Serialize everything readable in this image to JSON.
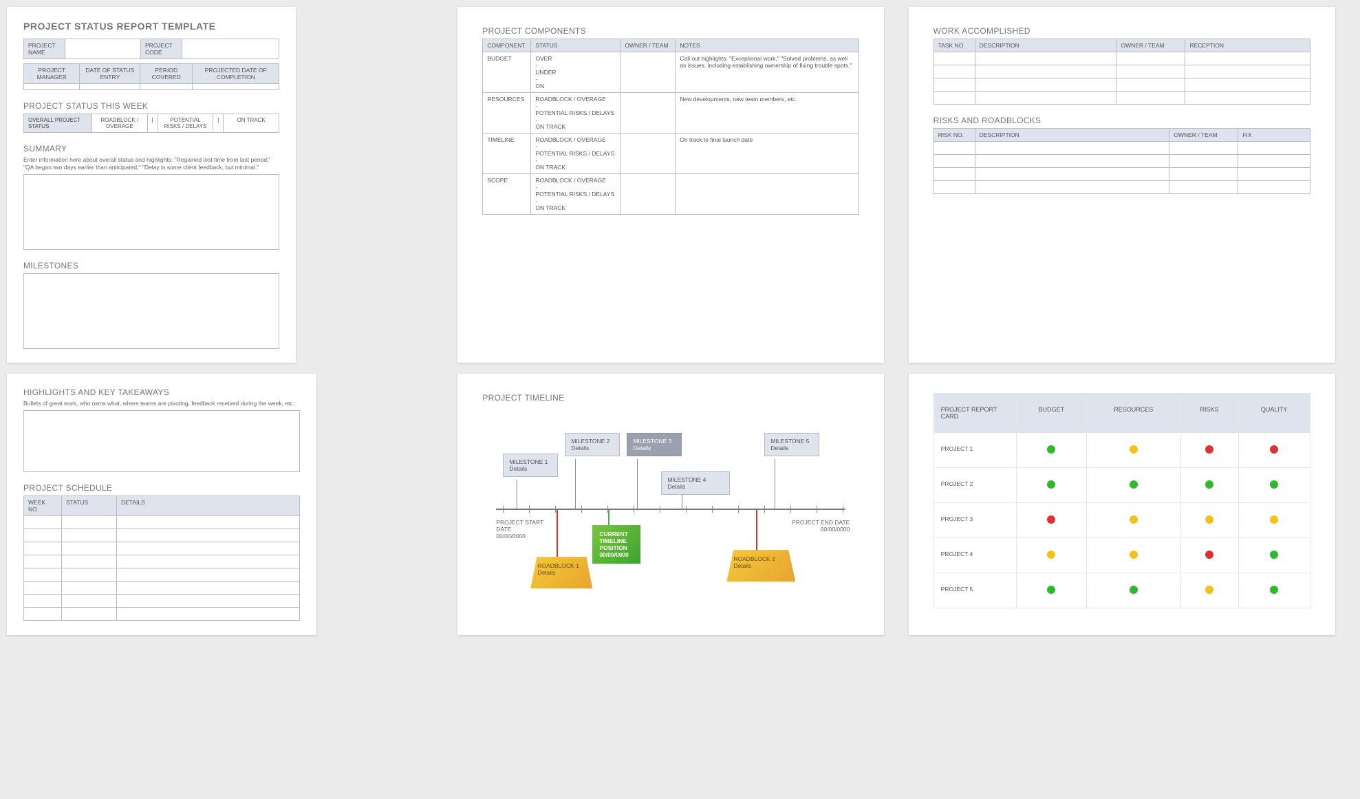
{
  "page1": {
    "title": "PROJECT STATUS REPORT TEMPLATE",
    "hdr": {
      "pname": "PROJECT NAME",
      "pcode": "PROJECT CODE"
    },
    "row2": [
      "PROJECT MANAGER",
      "DATE OF STATUS ENTRY",
      "PERIOD COVERED",
      "PROJECTED DATE OF COMPLETION"
    ],
    "status_title": "PROJECT STATUS THIS WEEK",
    "status_lbl": "OVERALL PROJECT STATUS",
    "status_opts": [
      "ROADBLOCK / OVERAGE",
      "|",
      "POTENTIAL RISKS / DELAYS",
      "|",
      "ON TRACK"
    ],
    "summary_t": "SUMMARY",
    "summary_hint": "Enter information here about overall status and highlights: \"Regained lost time from last period;\" \"QA began two days earlier than anticipated;\" \"Delay in some client feedback, but minimal.\"",
    "milestones_t": "MILESTONES"
  },
  "page2": {
    "title": "PROJECT COMPONENTS",
    "headers": [
      "COMPONENT",
      "STATUS",
      "OWNER / TEAM",
      "NOTES"
    ],
    "rows": [
      {
        "c": "BUDGET",
        "s": "OVER\n-\nUNDER\n-\nON",
        "n": "Call out highlights: \"Exceptional work,\" \"Solved problems, as well as issues, including establishing ownership of fixing trouble spots.\""
      },
      {
        "c": "RESOURCES",
        "s": "ROADBLOCK / OVERAGE\n-\nPOTENTIAL RISKS / DELAYS\n-\nON TRACK",
        "n": "New developments, new team members, etc."
      },
      {
        "c": "TIMELINE",
        "s": "ROADBLOCK / OVERAGE\n-\nPOTENTIAL RISKS / DELAYS\n-\nON TRACK",
        "n": "On track to final launch date"
      },
      {
        "c": "SCOPE",
        "s": "ROADBLOCK / OVERAGE\n-\nPOTENTIAL RISKS / DELAYS\n-\nON TRACK",
        "n": ""
      }
    ]
  },
  "page3": {
    "wa_title": "WORK ACCOMPLISHED",
    "wa_headers": [
      "TASK NO.",
      "DESCRIPTION",
      "OWNER / TEAM",
      "RECEPTION"
    ],
    "rr_title": "RISKS AND ROADBLOCKS",
    "rr_headers": [
      "RISK NO.",
      "DESCRIPTION",
      "OWNER / TEAM",
      "FIX"
    ]
  },
  "page4": {
    "hi_title": "HIGHLIGHTS AND KEY TAKEAWAYS",
    "hi_hint": "Bullets of great work, who owns what, where teams are pivoting, feedback received during the week, etc.",
    "ps_title": "PROJECT SCHEDULE",
    "ps_headers": [
      "WEEK NO.",
      "STATUS",
      "DETAILS"
    ]
  },
  "page5": {
    "title": "PROJECT TIMELINE",
    "start_lbl": "PROJECT START DATE",
    "end_lbl": "PROJECT END DATE",
    "date": "00/00/0000",
    "ms": [
      "MILESTONE 1",
      "MILESTONE 2",
      "MILESTONE 3",
      "MILESTONE 4",
      "MILESTONE 5"
    ],
    "details": "Details",
    "ctp_t": "CURRENT TIMELINE POSITION",
    "rb": [
      "ROADBLOCK 1",
      "ROADBLOCK 2"
    ]
  },
  "page6": {
    "headers": [
      "PROJECT REPORT CARD",
      "BUDGET",
      "RESOURCES",
      "RISKS",
      "QUALITY"
    ],
    "rows": [
      {
        "p": "PROJECT 1",
        "c": [
          "g",
          "y",
          "r",
          "r"
        ]
      },
      {
        "p": "PROJECT 2",
        "c": [
          "g",
          "g",
          "g",
          "g"
        ]
      },
      {
        "p": "PROJECT 3",
        "c": [
          "r",
          "y",
          "y",
          "y"
        ]
      },
      {
        "p": "PROJECT 4",
        "c": [
          "y",
          "y",
          "r",
          "g"
        ]
      },
      {
        "p": "PROJECT 5",
        "c": [
          "g",
          "g",
          "y",
          "g"
        ]
      }
    ]
  }
}
